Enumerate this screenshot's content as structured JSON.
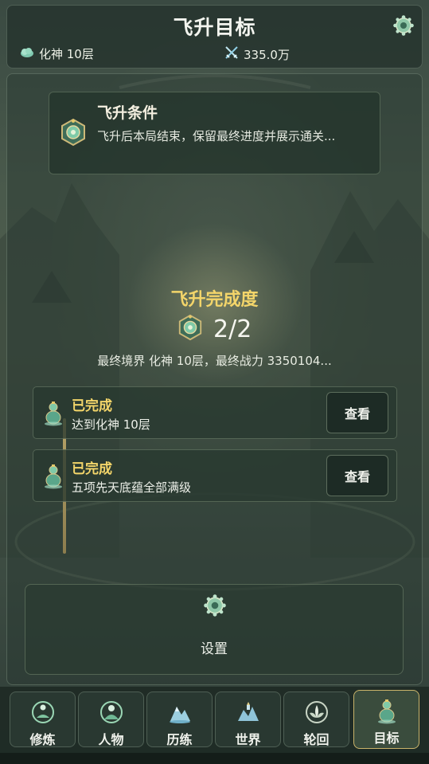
{
  "header": {
    "title": "飞升目标",
    "realm": "化神 10层",
    "power": "335.0万"
  },
  "condition": {
    "title": "飞升条件",
    "text": "飞升后本局结束，保留最终进度并展示通关..."
  },
  "progress": {
    "title": "飞升完成度",
    "value": "2/2",
    "subtitle": "最终境界 化神 10层，最终战力 3350104..."
  },
  "milestones": [
    {
      "status": "已完成",
      "text": "达到化神 10层",
      "button": "查看"
    },
    {
      "status": "已完成",
      "text": "五项先天底蕴全部满级",
      "button": "查看"
    }
  ],
  "settings": {
    "label": "设置"
  },
  "nav": {
    "items": [
      {
        "label": "修炼",
        "icon": "meditation-icon"
      },
      {
        "label": "人物",
        "icon": "character-icon"
      },
      {
        "label": "历练",
        "icon": "adventure-icon"
      },
      {
        "label": "世界",
        "icon": "world-icon"
      },
      {
        "label": "轮回",
        "icon": "lotus-icon"
      },
      {
        "label": "目标",
        "icon": "goal-icon"
      }
    ],
    "active_index": 5
  },
  "colors": {
    "accent_gold": "#f3d56a",
    "panel_bg": "#26342e",
    "active_border": "#c9b36a"
  }
}
